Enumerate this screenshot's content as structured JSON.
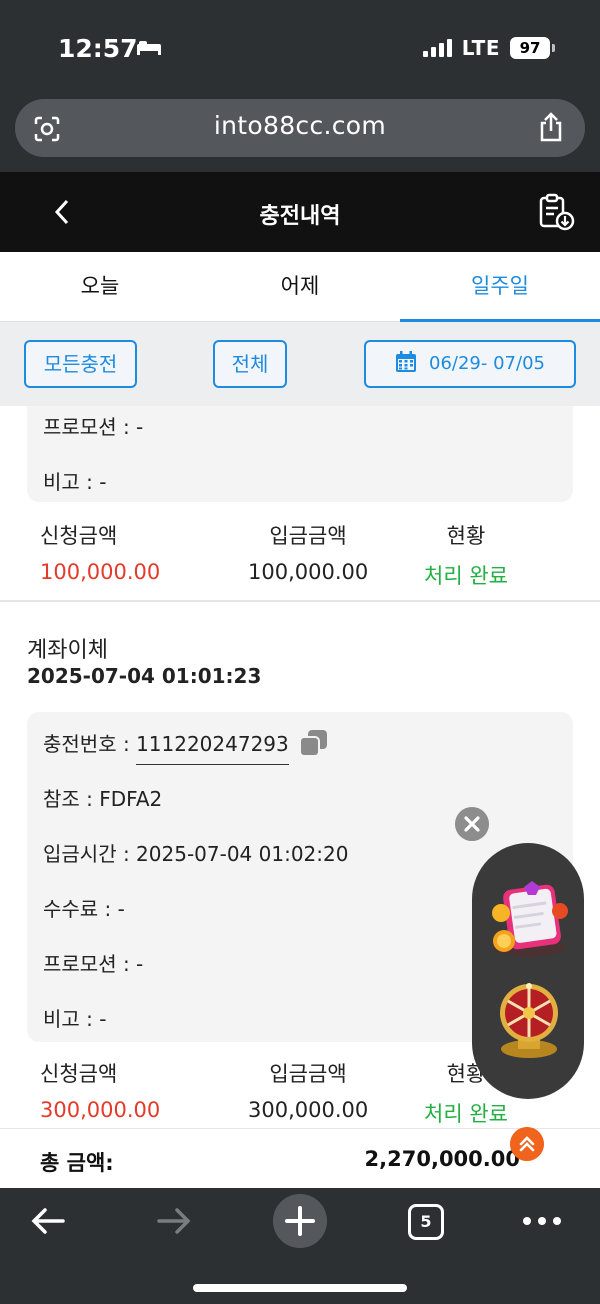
{
  "status_bar": {
    "time": "12:57",
    "network": "LTE",
    "battery": "97"
  },
  "browser": {
    "url": "into88cc.com",
    "tab_count": "5"
  },
  "header": {
    "title": "충전내역"
  },
  "tabs": [
    {
      "label": "오늘",
      "active": false
    },
    {
      "label": "어제",
      "active": false
    },
    {
      "label": "일주일",
      "active": true
    }
  ],
  "filters": {
    "charge_type": "모든충전",
    "status": "전체",
    "date_range": "06/29- 07/05"
  },
  "records": [
    {
      "details": {
        "promotion": "프로모션 : -",
        "note": "비고 : -"
      },
      "summary": {
        "requested_label": "신청금액",
        "requested_value": "100,000.00",
        "deposit_label": "입금금액",
        "deposit_value": "100,000.00",
        "status_label": "현황",
        "status_value": "처리 완료"
      }
    },
    {
      "type": "계좌이체",
      "datetime": "2025-07-04 01:01:23",
      "details": {
        "charge_no_label": "충전번호 : ",
        "charge_no": "111220247293",
        "reference": "참조 : FDFA2",
        "deposit_time": "입금시간 : 2025-07-04 01:02:20",
        "fee": "수수료 : -",
        "promotion": "프로모션 : -",
        "note": "비고 : -"
      },
      "summary": {
        "requested_label": "신청금액",
        "requested_value": "300,000.00",
        "deposit_label": "입금금액",
        "deposit_value": "300,000.00",
        "status_label": "현황",
        "status_value": "처리 완료"
      }
    }
  ],
  "total": {
    "label": "총 금액:",
    "value": "2,270,000.00"
  },
  "colors": {
    "accent": "#1d8be0",
    "requested": "#e53a2a",
    "status_done": "#22b043",
    "header_bg": "#111111"
  }
}
